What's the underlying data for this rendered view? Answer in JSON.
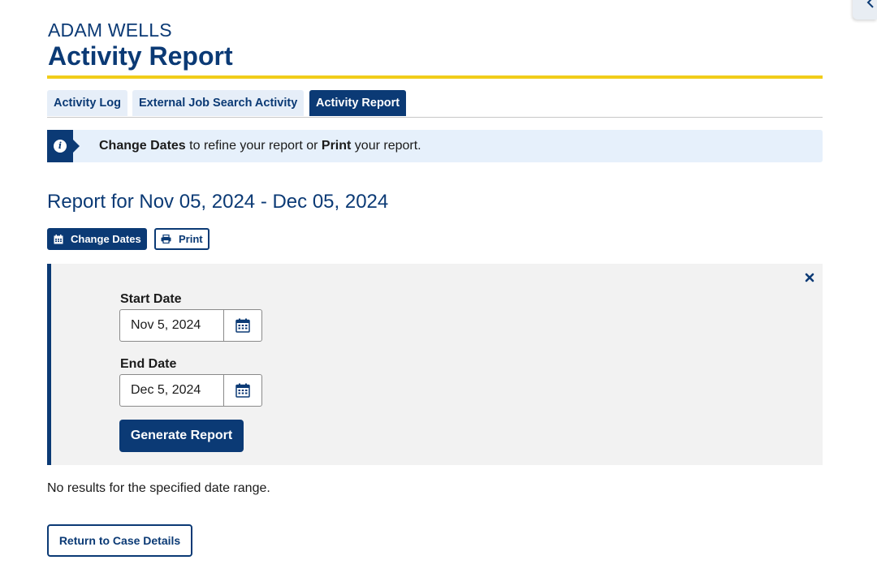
{
  "header": {
    "user_name": "ADAM WELLS",
    "page_title": "Activity Report"
  },
  "tabs": [
    {
      "label": "Activity Log",
      "active": false
    },
    {
      "label": "External Job Search Activity",
      "active": false
    },
    {
      "label": "Activity Report",
      "active": true
    }
  ],
  "alert": {
    "icon": "info-icon",
    "strong1": "Change Dates",
    "text1": " to refine your report or ",
    "strong2": "Print",
    "text2": " your report."
  },
  "report": {
    "heading": "Report for Nov 05, 2024 - Dec 05, 2024",
    "change_dates_label": "Change Dates",
    "print_label": "Print"
  },
  "date_form": {
    "start_label": "Start Date",
    "start_value": "Nov 5, 2024",
    "end_label": "End Date",
    "end_value": "Dec 5, 2024",
    "generate_label": "Generate Report"
  },
  "results": {
    "message": "No results for the specified date range."
  },
  "footer": {
    "return_label": "Return to Case Details"
  },
  "colors": {
    "primary": "#0b3a75",
    "accent_rule": "#f1cd1a",
    "alert_bg": "#e6f0fb",
    "panel_bg": "#f2f2f2"
  }
}
